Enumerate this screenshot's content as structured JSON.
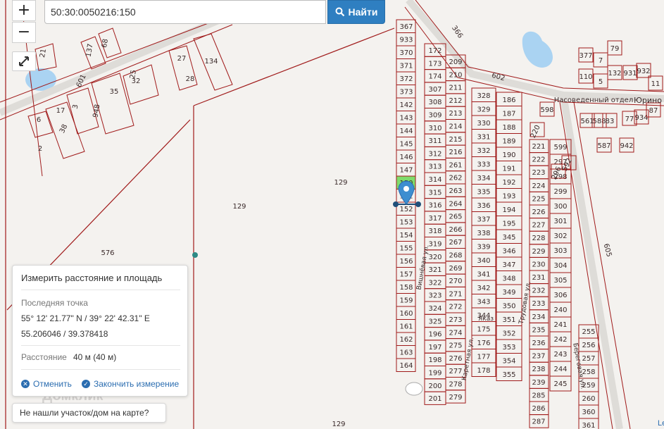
{
  "controls": {
    "zoom_in": "+",
    "zoom_out": "−",
    "fullscreen_icon": "expand-arrows-icon"
  },
  "search": {
    "value": "50:30:0050216:150",
    "button_label": "Найти",
    "button_icon": "search-icon"
  },
  "measure_panel": {
    "title": "Измерить расстояние и площадь",
    "last_point_label": "Последняя точка",
    "coords_dms": "55° 12' 21.77\" N / 39° 22' 42.31\" E",
    "coords_decimal": "55.206046 / 39.378418",
    "distance_label": "Расстояние",
    "distance_value": "40 м (40 м)",
    "cancel_label": "Отменить",
    "finish_label": "Закончить измерение"
  },
  "not_found_label": "Не нашли участок/дом на карте?",
  "watermark": "Домклик",
  "attribution": "Le",
  "colors": {
    "parcel_border": "#a01a1a",
    "accent": "#2f7fc1",
    "water": "#aad3f2",
    "selected_parcel": "#7fdc6c"
  },
  "map": {
    "parcel_labels": {
      "left_column": [
        "367",
        "933",
        "370",
        "371",
        "372",
        "373",
        "142",
        "143",
        "144",
        "145",
        "146",
        "147",
        "150",
        "151",
        "152",
        "153",
        "154",
        "155",
        "156",
        "157",
        "158",
        "159",
        "160",
        "161",
        "162",
        "163",
        "164"
      ],
      "col_a": [
        "172",
        "173",
        "174",
        "307",
        "308",
        "309",
        "310",
        "311",
        "312",
        "313",
        "314",
        "315",
        "316",
        "317",
        "318",
        "319",
        "320",
        "321",
        "322",
        "323",
        "324",
        "325",
        "196",
        "197",
        "198",
        "199",
        "200",
        "201"
      ],
      "col_b": [
        "209",
        "210",
        "211",
        "212",
        "213",
        "214",
        "215",
        "216",
        "261",
        "262",
        "263",
        "264",
        "265",
        "266",
        "267",
        "268",
        "269",
        "270",
        "271",
        "272",
        "273",
        "274",
        "275",
        "276",
        "277",
        "278",
        "279"
      ],
      "col_c": [
        "328",
        "329",
        "330",
        "331",
        "332",
        "333",
        "334",
        "335",
        "336",
        "337",
        "338",
        "339",
        "340",
        "341",
        "342",
        "343",
        "344",
        "175",
        "176",
        "177",
        "178"
      ],
      "col_d": [
        "186",
        "187",
        "188",
        "189",
        "190",
        "191",
        "192",
        "193",
        "194",
        "195",
        "345",
        "346",
        "347",
        "348",
        "349",
        "350",
        "351",
        "352",
        "353",
        "354",
        "355"
      ],
      "col_e": [
        "221",
        "222",
        "223",
        "224",
        "225",
        "226",
        "227",
        "228",
        "229",
        "230",
        "231",
        "232",
        "233",
        "234",
        "235",
        "236",
        "237",
        "238",
        "239",
        "285",
        "286",
        "287"
      ],
      "col_f": [
        "599",
        "297",
        "298",
        "299",
        "300",
        "301",
        "302",
        "303",
        "304",
        "305",
        "306",
        "240",
        "241",
        "242",
        "243",
        "244",
        "245"
      ],
      "col_g": [
        "255",
        "256",
        "257",
        "258",
        "259",
        "260",
        "360",
        "361"
      ],
      "top_right": [
        "377",
        "7",
        "79",
        "110",
        "5",
        "132",
        "931",
        "932",
        "77",
        "934",
        "942",
        "587",
        "588",
        "83",
        "561",
        "87",
        "11",
        "598",
        "220",
        "296",
        "592"
      ],
      "top_left": [
        "21",
        "137",
        "68",
        "27",
        "28",
        "134",
        "25",
        "35",
        "32",
        "601",
        "17",
        "3",
        "948",
        "38",
        "6",
        "2"
      ],
      "large_areas": [
        "129",
        "129",
        "576",
        "129",
        "602",
        "605",
        "595",
        "366"
      ],
      "streets": [
        "Вишнёвая ул.",
        "Каретная ул.",
        "Трудовая ул.",
        "Береговая ул.",
        "Яказ"
      ],
      "place_names": [
        "Насоведенный отдел",
        "Юрино"
      ]
    }
  }
}
